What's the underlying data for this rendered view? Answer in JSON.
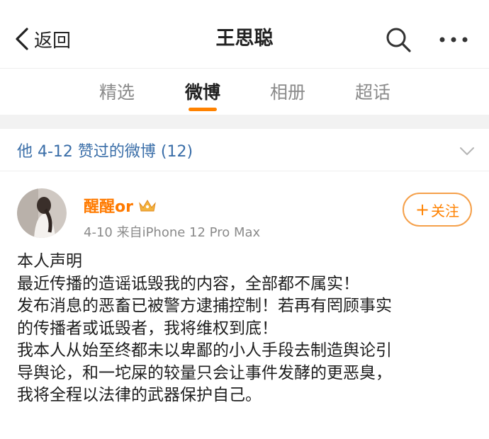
{
  "nav": {
    "back_label": "返回",
    "title": "王思聪",
    "icons": [
      "back-chevron-icon",
      "search-icon",
      "more-icon"
    ]
  },
  "tabs": [
    {
      "label": "精选",
      "active": false
    },
    {
      "label": "微博",
      "active": true
    },
    {
      "label": "相册",
      "active": false
    },
    {
      "label": "超话",
      "active": false
    }
  ],
  "liked_section": {
    "text": "他 4-12 赞过的微博 (12)"
  },
  "post": {
    "author": "醒醒or",
    "badge_icon": "crown-icon",
    "meta": "4-10  来自iPhone 12 Pro Max",
    "follow_label": "关注",
    "lines": [
      "本人声明",
      "最近传播的造谣诋毁我的内容，全部都不属实！",
      "发布消息的恶畜已被警方逮捕控制！若再有罔顾事实",
      "的传播者或诋毁者，我将维权到底！",
      "我本人从始至终都未以卑鄙的小人手段去制造舆论引",
      "导舆论，和一坨屎的较量只会让事件发酵的更恶臭，",
      "我将全程以法律的武器保护自己。"
    ]
  },
  "colors": {
    "accent": "#ff8200",
    "link_blue": "#3a6ea8",
    "author_orange": "#ff7a00"
  }
}
